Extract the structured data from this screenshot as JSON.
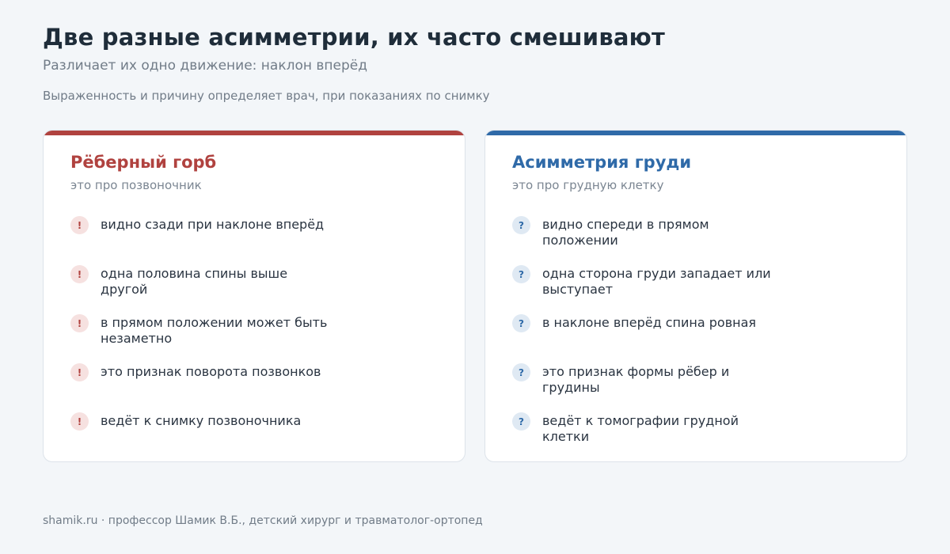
{
  "header": {
    "title": "Две разные асимметрии, их часто смешивают",
    "subtitle": "Различает их одно движение: наклон вперёд",
    "note": "Выраженность и причину определяет врач, при показаниях по снимку"
  },
  "cards": [
    {
      "title": "Рёберный горб",
      "subtitle": "это про позвоночник",
      "accent_color": "#b0423f",
      "badge_glyph": "!",
      "items": [
        "видно сзади при наклоне вперёд",
        "одна половина спины выше другой",
        "в прямом положении может быть незаметно",
        "это признак поворота позвонков",
        "ведёт к снимку позвоночника"
      ]
    },
    {
      "title": "Асимметрия груди",
      "subtitle": "это про грудную клетку",
      "accent_color": "#2f6aa8",
      "badge_glyph": "?",
      "items": [
        "видно спереди в прямом положении",
        "одна сторона груди западает или выступает",
        "в наклоне вперёд спина ровная",
        "это признак формы рёбер и грудины",
        "ведёт к томографии грудной клетки"
      ]
    }
  ],
  "footer": {
    "text": "shamik.ru · профессор Шамик В.Б., детский хирург и травматолог-ортопед"
  }
}
